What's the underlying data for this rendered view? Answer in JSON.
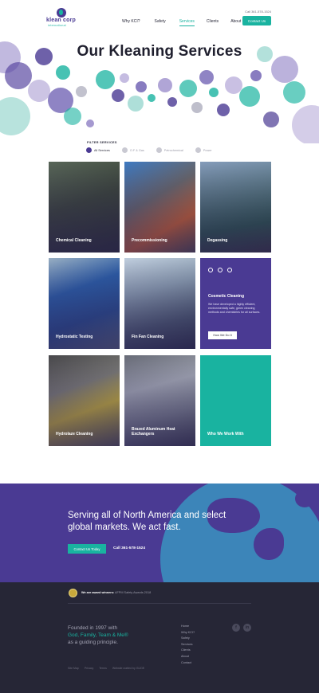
{
  "brand": {
    "logo_name": "klean corp",
    "logo_sub": "international",
    "phone": "Call 361-578-1524",
    "colors": {
      "purple": "#4a3a93",
      "teal": "#19b3a0",
      "footer": "#262636"
    }
  },
  "nav": {
    "items": [
      {
        "label": "Why KCI?"
      },
      {
        "label": "Safety"
      },
      {
        "label": "Services"
      },
      {
        "label": "Clients"
      },
      {
        "label": "About"
      }
    ],
    "active": "Services",
    "contact_label": "Contact Us"
  },
  "hero": {
    "title": "Our Kleaning Services"
  },
  "filters": {
    "label": "FILTER SERVICES",
    "items": [
      {
        "label": "All Services",
        "icon": "grid-icon"
      },
      {
        "label": "O.F & Gas",
        "icon": "oil-drop-icon"
      },
      {
        "label": "Petrochemical",
        "icon": "refinery-icon"
      },
      {
        "label": "Power",
        "icon": "power-icon"
      }
    ]
  },
  "services": [
    {
      "label": "Chemical Cleaning"
    },
    {
      "label": "Precommissioning"
    },
    {
      "label": "Degassing"
    },
    {
      "label": "Hydrostatic Testing"
    },
    {
      "label": "Fin Fan Cleaning"
    },
    {
      "label": "Cosmetic Cleaning",
      "description": "We have developed a highly efficient, environmentally safe, green cleaning methods and chemistries for all surfaces.",
      "button": "How We Do It"
    },
    {
      "label": "Hydrolaze Cleaning"
    },
    {
      "label": "Brazed Aluminum Heat Exchangers"
    },
    {
      "label": "Who We Work With"
    }
  ],
  "band": {
    "headline": "Serving all of North America and select global markets. We act fast.",
    "button": "Contact Us Today",
    "phone": "Call 361-578-1524"
  },
  "footer": {
    "award_bold": "We are award winners:",
    "award_detail": "AFPM Safety Awards 2018",
    "founded_pre": "Founded in 1997 with",
    "founded_highlight": "God, Family, Team & Me®",
    "founded_post": "as a guiding principle.",
    "links": [
      "Home",
      "Why KCI?",
      "Safety",
      "Services",
      "Clients",
      "About",
      "Contact"
    ],
    "social": [
      "facebook-icon",
      "linkedin-icon"
    ],
    "legal": [
      "Site Map",
      "Privacy",
      "Terms",
      "Website crafted by GLIDE"
    ]
  }
}
